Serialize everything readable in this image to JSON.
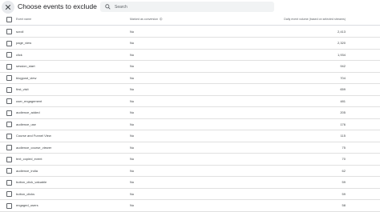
{
  "header": {
    "title": "Choose events to exclude",
    "close_icon": "close-icon",
    "search": {
      "placeholder": "Search",
      "value": ""
    }
  },
  "table": {
    "columns": {
      "event_name": "Event name",
      "marked_as_conversion": "Marked as conversion",
      "daily_volume": "Daily event volume (based on selected streams)"
    },
    "rows": [
      {
        "name": "scroll",
        "conversion": "No",
        "volume": "2,413"
      },
      {
        "name": "page_view",
        "conversion": "No",
        "volume": "2,320"
      },
      {
        "name": "click",
        "conversion": "No",
        "volume": "1,934"
      },
      {
        "name": "session_start",
        "conversion": "No",
        "volume": "942"
      },
      {
        "name": "blogpost_view",
        "conversion": "No",
        "volume": "704"
      },
      {
        "name": "first_visit",
        "conversion": "No",
        "volume": "659"
      },
      {
        "name": "user_engagement",
        "conversion": "No",
        "volume": "481"
      },
      {
        "name": "audience_added",
        "conversion": "No",
        "volume": "205"
      },
      {
        "name": "audience_use",
        "conversion": "No",
        "volume": "176"
      },
      {
        "name": "Course and Funnel View",
        "conversion": "No",
        "volume": "115"
      },
      {
        "name": "audience_course_viewer",
        "conversion": "No",
        "volume": "75"
      },
      {
        "name": "text_copied_event",
        "conversion": "No",
        "volume": "70"
      },
      {
        "name": "audience_india",
        "conversion": "No",
        "volume": "62"
      },
      {
        "name": "button_click_valuable",
        "conversion": "No",
        "volume": "59"
      },
      {
        "name": "button_clicks",
        "conversion": "No",
        "volume": "59"
      },
      {
        "name": "engaged_users",
        "conversion": "No",
        "volume": "58"
      }
    ]
  }
}
